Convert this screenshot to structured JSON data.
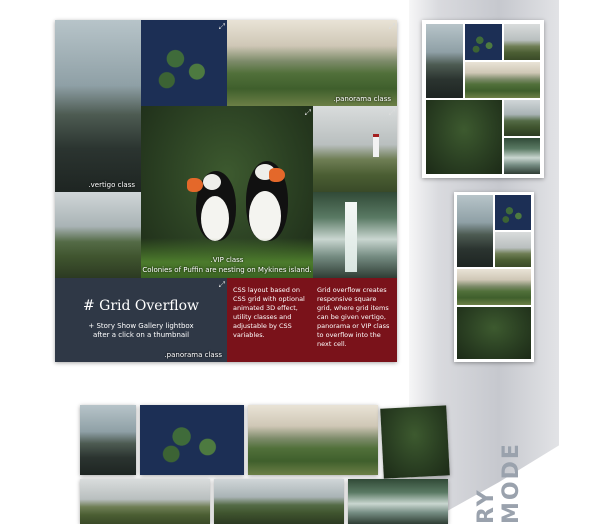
{
  "main": {
    "title": "# Grid Overflow",
    "subtitle": "+ Story Show Gallery lightbox",
    "subtitle2": "after a click on a thumbnail",
    "panel_caption": ".panorama class",
    "red1_text": "CSS layout based on CSS grid with optional animated 3D effect, utility classes and adjustable by CSS variables.",
    "red2_text": "Grid overflow creates responsive square grid, where grid items can be given vertigo, panorama or VIP class to overflow into the next cell.",
    "captions": {
      "pano": ".panorama class",
      "vertigo": ".vertigo class",
      "vip": ".VIP class",
      "vip_line2": "Colonies of Puffin are nesting on Mykines island."
    }
  },
  "bottom": {
    "vertical_label": "RY MODE"
  },
  "icons": {
    "expand": "expand-icon"
  }
}
